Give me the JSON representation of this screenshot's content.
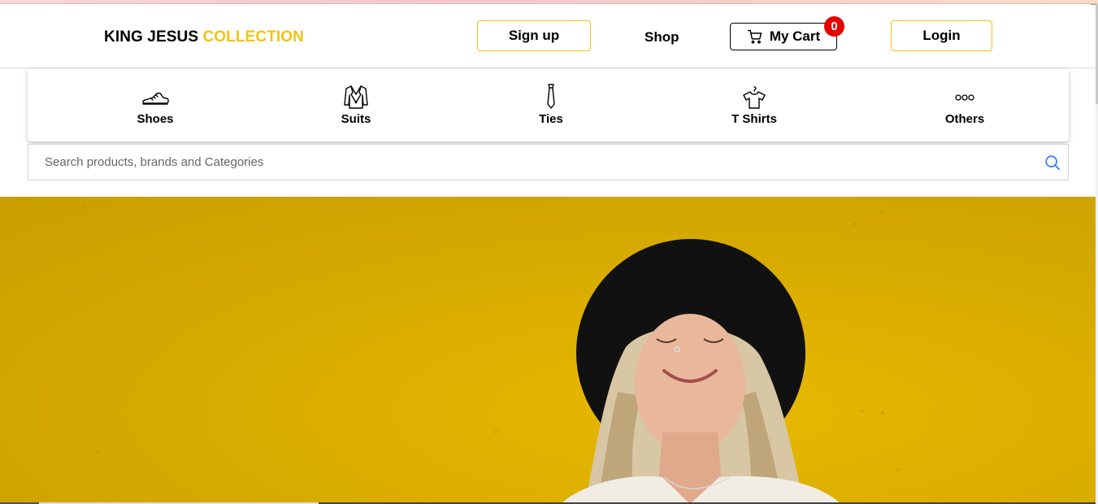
{
  "header": {
    "logo_main": "KING JESUS",
    "logo_accent": "COLLECTION",
    "signup_label": "Sign up",
    "shop_label": "Shop",
    "cart_label": "My Cart",
    "cart_count": "0",
    "login_label": "Login"
  },
  "categories": [
    {
      "label": "Shoes",
      "icon": "shoe-icon"
    },
    {
      "label": "Suits",
      "icon": "suit-icon"
    },
    {
      "label": "Ties",
      "icon": "tie-icon"
    },
    {
      "label": "T Shirts",
      "icon": "tshirt-icon"
    },
    {
      "label": "Others",
      "icon": "more-icon"
    }
  ],
  "search": {
    "placeholder": "Search products, brands and Categories",
    "value": ""
  },
  "colors": {
    "accent": "#f1c40f",
    "badge": "#e60000",
    "hero_background": "#d9ac00",
    "search_icon": "#3b82f6"
  },
  "hero": {
    "image": "woman-with-black-hat-smiling-on-yellow-background"
  }
}
